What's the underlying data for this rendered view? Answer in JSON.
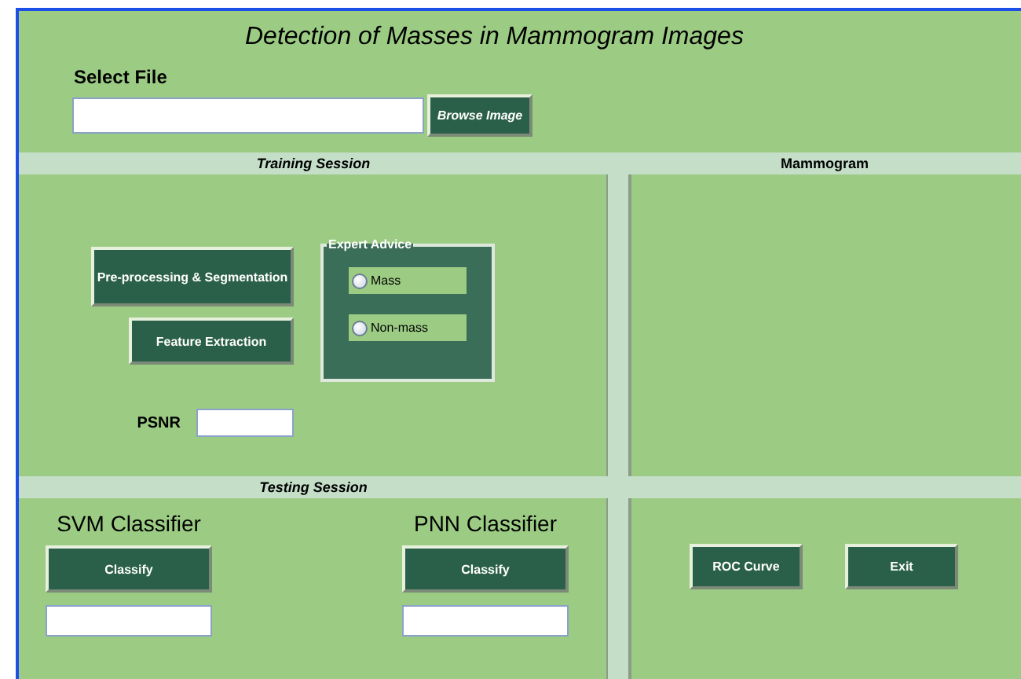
{
  "window": {
    "title": "Detection of Masses in Mammogram Images"
  },
  "file": {
    "label": "Select File",
    "button": "Browse Image"
  },
  "training": {
    "title": "Training Session",
    "buttons": [
      "Pre-processing & Segmentation",
      "Feature Extraction"
    ],
    "expert_advice": {
      "title": "Expert Advice",
      "options": [
        {
          "label": "Mass",
          "selected": false
        },
        {
          "label": "Non-mass",
          "selected": false
        }
      ]
    },
    "psnr": {
      "label": "PSNR"
    }
  },
  "mammogram": {
    "title": "Mammogram"
  },
  "testing": {
    "title": "Testing Session",
    "classifiers": [
      {
        "name": "SVM Classifier",
        "button": "Classify"
      },
      {
        "name": "PNN Classifier",
        "button": "Classify"
      }
    ]
  },
  "actions": [
    "ROC Curve",
    "Exit"
  ]
}
